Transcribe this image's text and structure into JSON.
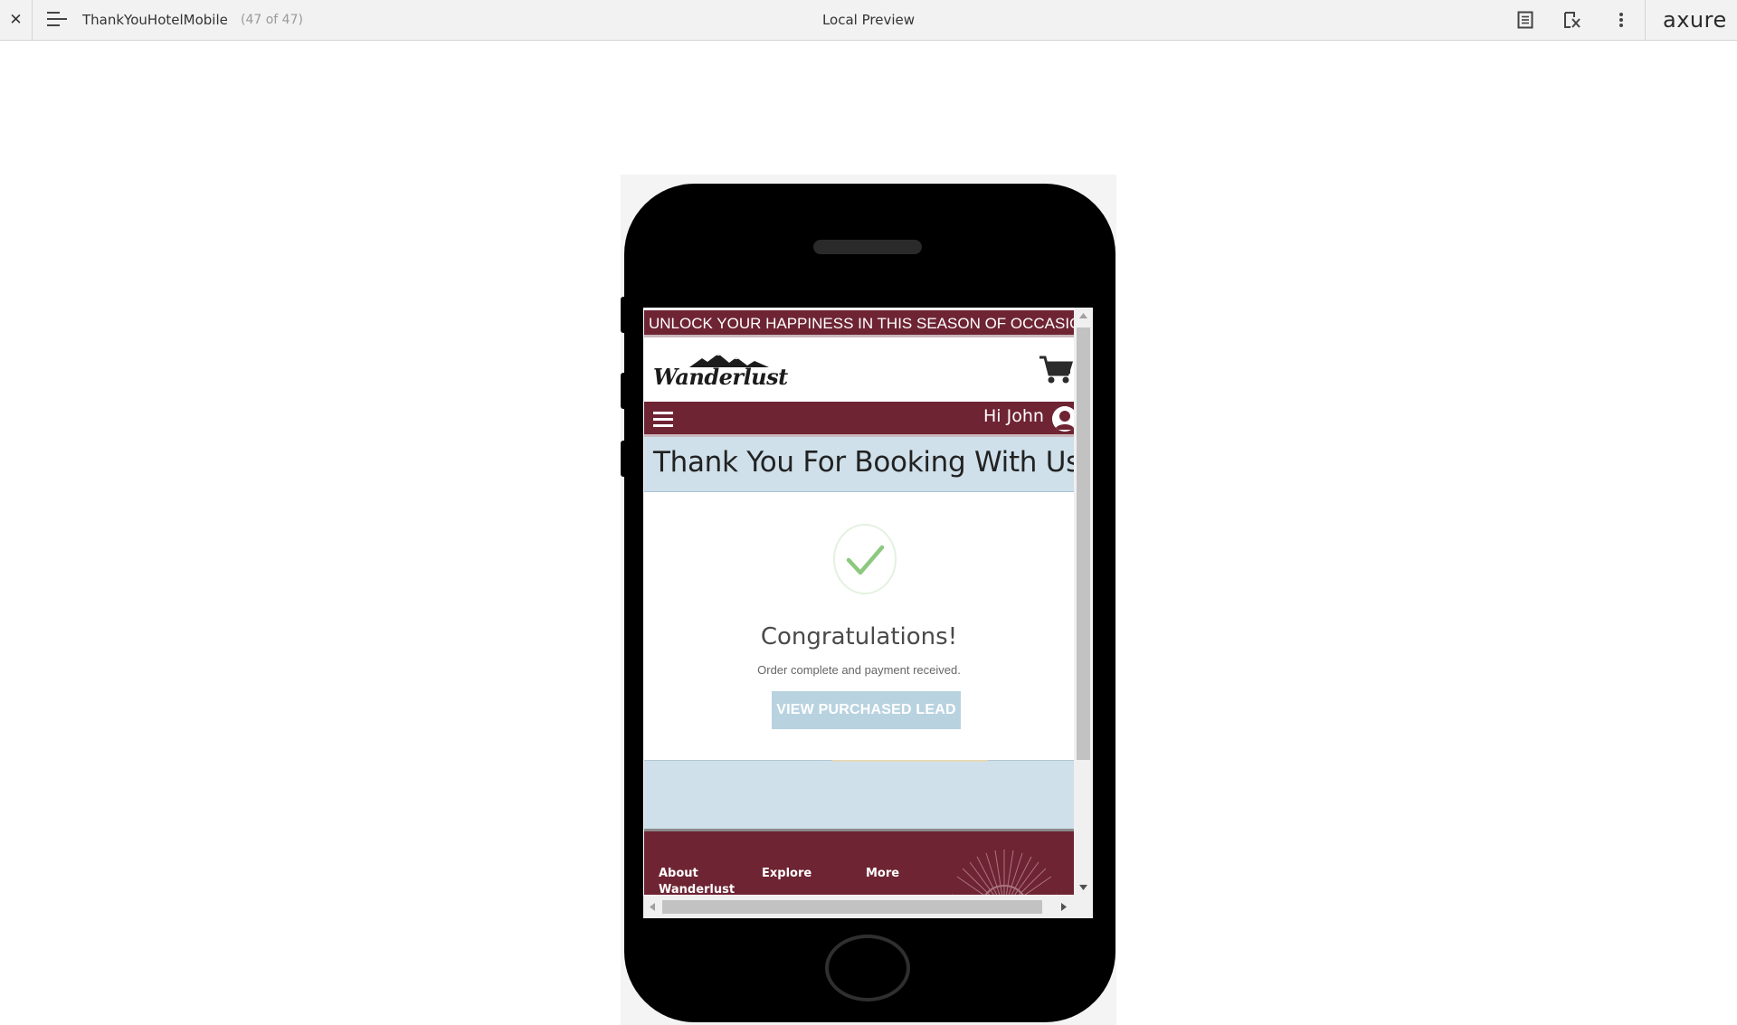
{
  "toolbar": {
    "close_glyph": "✕",
    "page_name": "ThankYouHotelMobile",
    "page_count": "(47 of 47)",
    "title": "Local Preview",
    "brand": "axure"
  },
  "site": {
    "promo_banner": "UNLOCK YOUR HAPPINESS IN THIS SEASON OF OCCASIONS",
    "logo_text": "Wanderlust",
    "greeting": "Hi John",
    "heading": "Thank You For Booking With Us",
    "congrats_title": "Congratulations!",
    "congrats_subtext": "Order complete and payment received.",
    "view_button": "VIEW PURCHASED LEAD",
    "footer_links": [
      "About Wanderlust",
      "Explore",
      "More"
    ]
  },
  "colors": {
    "brand_maroon": "#6e2433",
    "light_blue_band": "#cfe0ea",
    "button_blue": "#b8d2e0",
    "check_green": "#8cc97e"
  }
}
